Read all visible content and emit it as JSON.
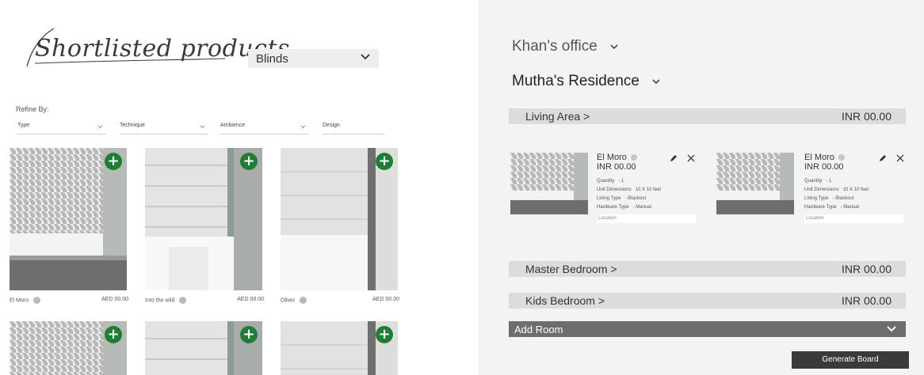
{
  "left": {
    "title": "Shortlisted products",
    "category": {
      "selected": "Blinds"
    },
    "refine_label": "Refine By:",
    "filters": [
      {
        "label": "Type"
      },
      {
        "label": "Technique"
      },
      {
        "label": "Ambience"
      },
      {
        "label": "Design"
      }
    ],
    "products": [
      {
        "name": "El Moro",
        "price": "AED 00.00",
        "pattern": "houndstooth"
      },
      {
        "name": "Into the wild",
        "price": "AED 00.00",
        "pattern": "plain-trim"
      },
      {
        "name": "Oliver",
        "price": "AED 00.00",
        "pattern": "plain"
      },
      {
        "name": "",
        "price": "",
        "pattern": "houndstooth"
      },
      {
        "name": "",
        "price": "",
        "pattern": "plain-trim"
      },
      {
        "name": "",
        "price": "",
        "pattern": "plain"
      }
    ]
  },
  "right": {
    "projects": [
      {
        "name": "Khan's office"
      },
      {
        "name": "Mutha's Residence"
      }
    ],
    "rooms": [
      {
        "name": "Living Area >",
        "total": "INR 00.00"
      },
      {
        "name": "Master Bedroom >",
        "total": "INR 00.00"
      },
      {
        "name": "Kids Bedroom >",
        "total": "INR 00.00"
      }
    ],
    "room_items": [
      {
        "name": "El Moro",
        "price": "INR 00.00",
        "specs": [
          {
            "label": "Quantity",
            "value": "- 1"
          },
          {
            "label": "Unit Dimensions",
            "value": "10 X 10 feet"
          },
          {
            "label": "Lining Type",
            "value": "- Blackout"
          },
          {
            "label": "Hardware Type",
            "value": "- Manual"
          }
        ],
        "location_placeholder": "Location"
      },
      {
        "name": "El Moro",
        "price": "INR 00.00",
        "specs": [
          {
            "label": "Quantity",
            "value": "- 1"
          },
          {
            "label": "Unit Dimensions",
            "value": "10 X 10 feet"
          },
          {
            "label": "Lining Type",
            "value": "- Blackout"
          },
          {
            "label": "Hardware Type",
            "value": "- Manual"
          }
        ],
        "location_placeholder": "Location"
      }
    ],
    "add_room_label": "Add Room",
    "generate_label": "Generate Board"
  },
  "colors": {
    "accent_green": "#1f7d34",
    "panel_bg": "#f3f3f3",
    "room_bar": "#dcdcdc",
    "add_room_bar": "#6d6d6d",
    "button_dark": "#3a3a3a"
  }
}
